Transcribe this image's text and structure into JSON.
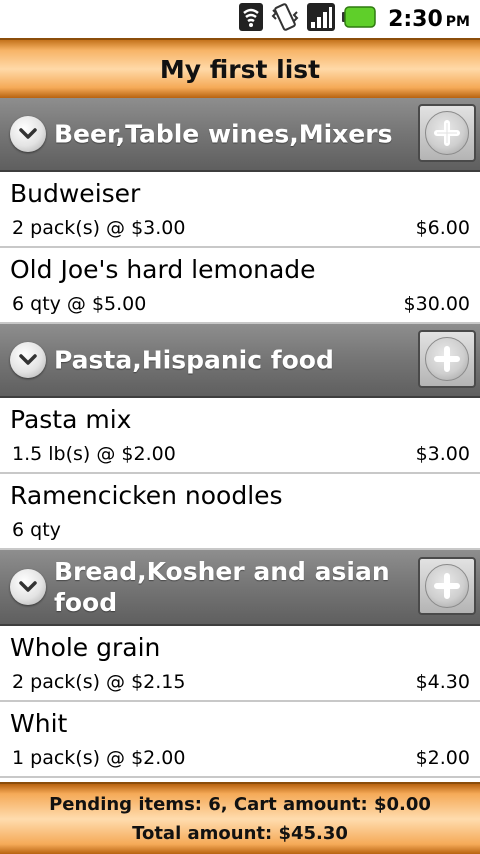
{
  "status_bar": {
    "time": "2:30",
    "ampm": "PM",
    "icons": [
      "wifi-icon",
      "vibrate-icon",
      "signal-icon",
      "battery-icon"
    ]
  },
  "title": "My first list",
  "categories": [
    {
      "name": "Beer,Table wines,Mixers",
      "items": [
        {
          "name": "Budweiser",
          "detail": "2 pack(s) @ $3.00",
          "total": "$6.00"
        },
        {
          "name": "Old Joe's hard lemonade",
          "detail": "6 qty @ $5.00",
          "total": "$30.00"
        }
      ]
    },
    {
      "name": "Pasta,Hispanic food",
      "items": [
        {
          "name": "Pasta mix",
          "detail": "1.5 lb(s) @ $2.00",
          "total": "$3.00"
        },
        {
          "name": "Ramencicken noodles",
          "detail": "6 qty",
          "total": ""
        }
      ]
    },
    {
      "name": "Bread,Kosher and asian food",
      "items": [
        {
          "name": "Whole grain",
          "detail": "2 pack(s) @ $2.15",
          "total": "$4.30"
        },
        {
          "name": "Whit",
          "detail": "1 pack(s) @ $2.00",
          "total": "$2.00"
        }
      ]
    }
  ],
  "footer": {
    "line1": "Pending items: 6, Cart amount: $0.00",
    "line2": "Total amount: $45.30"
  },
  "colors": {
    "title_bar": "#f7b467",
    "category_header": "#777777",
    "battery": "#5fcf2a"
  }
}
